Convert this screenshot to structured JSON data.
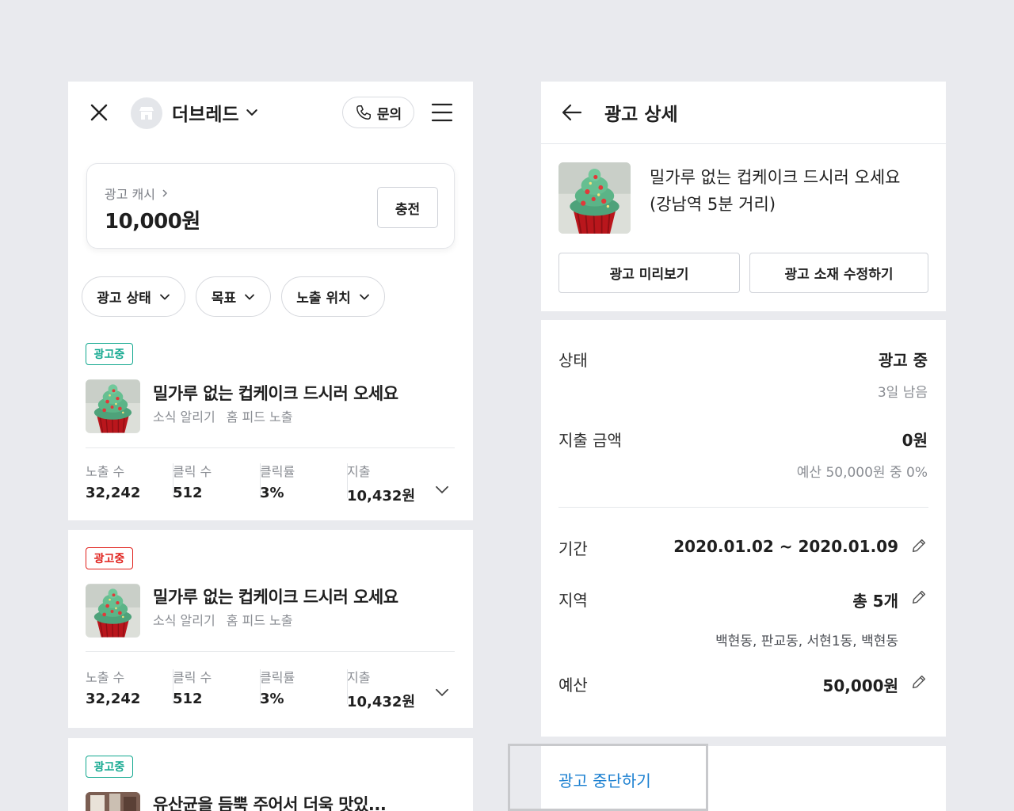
{
  "left": {
    "store_name": "더브레드",
    "inquiry_label": "문의",
    "cash": {
      "label": "광고 캐시",
      "value": "10,000원",
      "charge_label": "충전"
    },
    "filters": [
      {
        "label": "광고 상태"
      },
      {
        "label": "목표"
      },
      {
        "label": "노출 위치"
      }
    ],
    "ads": [
      {
        "badge": "광고중",
        "badge_color": "#12a88f",
        "title": "밀가루 없는 컵케이크 드시러 오세요",
        "type": "소식 알리기",
        "placement": "홈 피드 노출",
        "stats": [
          {
            "label": "노출 수",
            "value": "32,242"
          },
          {
            "label": "클릭 수",
            "value": "512"
          },
          {
            "label": "클릭률",
            "value": "3%"
          },
          {
            "label": "지출",
            "value": "10,432원"
          }
        ]
      },
      {
        "badge": "광고중",
        "badge_color": "#e0201b",
        "title": "밀가루 없는 컵케이크 드시러 오세요",
        "type": "소식 알리기",
        "placement": "홈 피드 노출",
        "stats": [
          {
            "label": "노출 수",
            "value": "32,242"
          },
          {
            "label": "클릭 수",
            "value": "512"
          },
          {
            "label": "클릭률",
            "value": "3%"
          },
          {
            "label": "지출",
            "value": "10,432원"
          }
        ]
      },
      {
        "badge": "광고중",
        "badge_color": "#12a88f",
        "title": "유산균을 듬뿍 주어서 더욱 맛있..."
      }
    ]
  },
  "right": {
    "header_title": "광고 상세",
    "ad_title_line1": "밀가루 없는 컵케이크 드시러 오세요",
    "ad_title_line2": "(강남역 5분 거리)",
    "preview_label": "광고 미리보기",
    "edit_label": "광고 소재 수정하기",
    "status": {
      "label": "상태",
      "value": "광고 중",
      "note": "3일 남음"
    },
    "spend": {
      "label": "지출 금액",
      "value": "0원",
      "note": "예산 50,000원 중 0%"
    },
    "period": {
      "label": "기간",
      "value": "2020.01.02 ~ 2020.01.09"
    },
    "region": {
      "label": "지역",
      "value": "총 5개",
      "note": "백현동, 판교동, 서현1동, 백현동"
    },
    "budget": {
      "label": "예산",
      "value": "50,000원"
    },
    "stop_label": "광고 중단하기"
  }
}
